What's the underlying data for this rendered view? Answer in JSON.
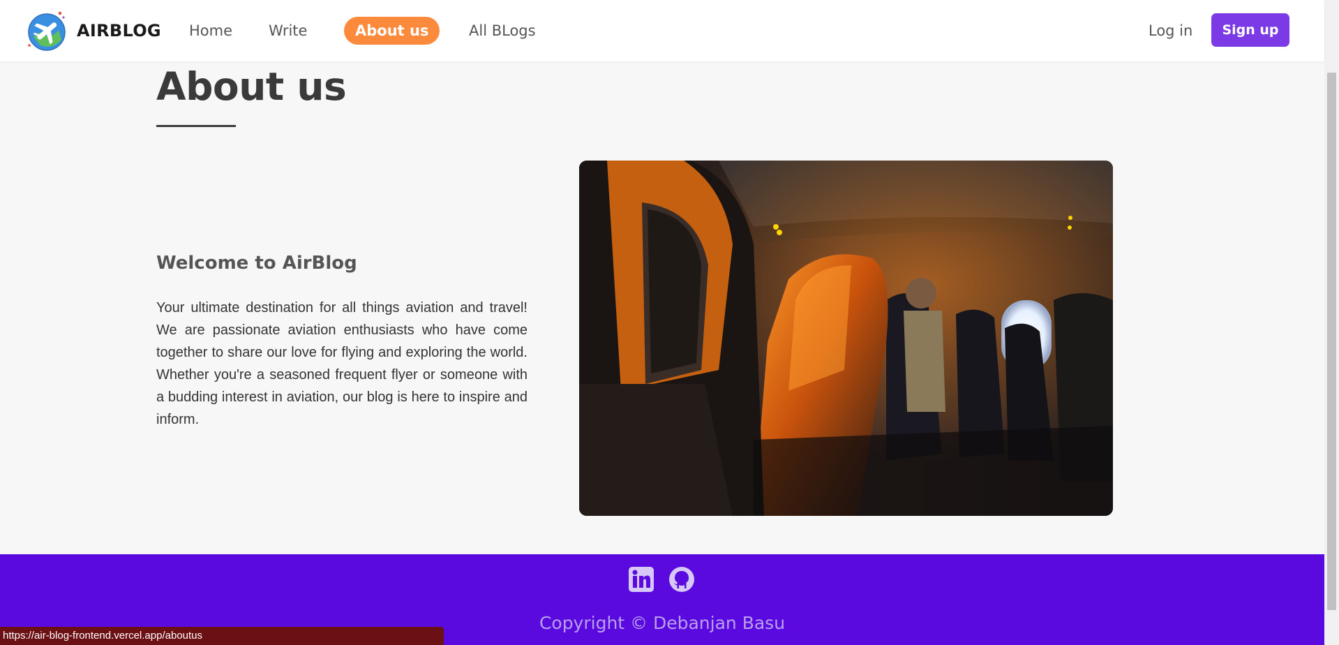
{
  "nav": {
    "brand": "AIRBLOG",
    "links": [
      "Home",
      "Write",
      "About us",
      "All BLogs"
    ],
    "active": "About us",
    "login": "Log in",
    "signup": "Sign up"
  },
  "main": {
    "title": "About us",
    "subtitle": "Welcome to AirBlog",
    "text": "Your ultimate destination for all things aviation and travel! We are passionate aviation enthusiasts who have come together to share our love for flying and exploring the world. Whether you're a seasoned frequent flyer or someone with a budding interest in aviation, our blog is here to inspire and inform."
  },
  "footer": {
    "copyright": "Copyright © Debanjan Basu",
    "social": [
      "linkedin-icon",
      "github-icon"
    ]
  },
  "status_url": "https://air-blog-frontend.vercel.app/aboutus",
  "colors": {
    "accent": "#fb8a3c",
    "primary": "#7c3ae6",
    "footer": "#5a0ade"
  }
}
